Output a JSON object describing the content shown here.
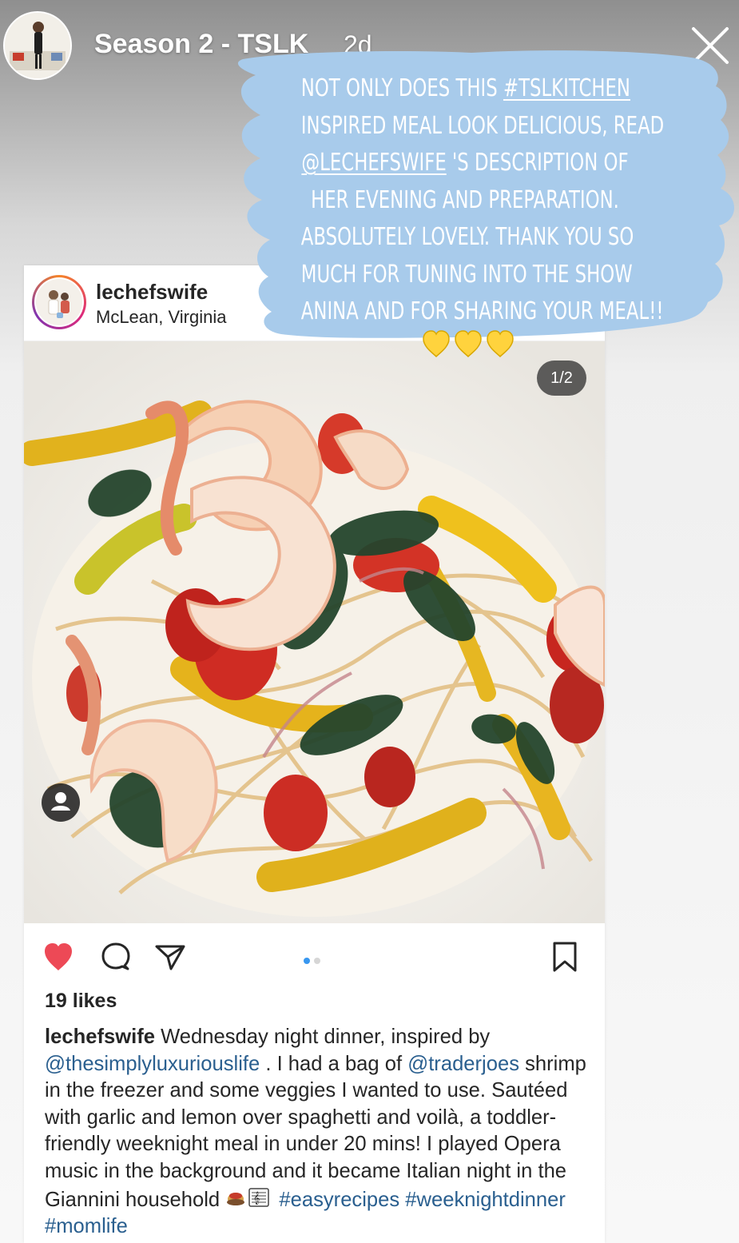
{
  "story": {
    "title": "Season 2 - TSLK",
    "time": "2d",
    "overlay_lines": [
      {
        "parts": [
          {
            "text": "Not only does this "
          },
          {
            "text": "#TSLKitchen",
            "u": true
          }
        ]
      },
      {
        "parts": [
          {
            "text": "inspired meal look delicious, read"
          }
        ]
      },
      {
        "parts": [
          {
            "text": "@lechefswife",
            "u": true
          },
          {
            "text": " 's description of"
          }
        ]
      },
      {
        "parts": [
          {
            "text": "her evening and preparation."
          }
        ]
      },
      {
        "parts": [
          {
            "text": "Absolutely lovely. Thank you so"
          }
        ]
      },
      {
        "parts": [
          {
            "text": "much for tuning into the show"
          }
        ]
      },
      {
        "parts": [
          {
            "text": "Anina and for sharing your meal!!"
          }
        ]
      }
    ],
    "overlay_hearts": "yellow-heart-emoji",
    "bubble_color": "#a8cbeb"
  },
  "post": {
    "username": "lechefswife",
    "location": "McLean, Virginia",
    "image_counter": "1/2",
    "likes": "19 likes",
    "caption": {
      "username": "lechefswife",
      "t1": " Wednesday night dinner, inspired by ",
      "mention1": "@thesimplyluxuriouslife",
      "t2": " . I had a bag of ",
      "mention2": "@traderjoes",
      "t3": " shrimp in the freezer and some veggies I wanted to use. Sautéed with garlic and lemon over spaghetti and voilà, a toddler-friendly weeknight meal in under 20 mins! I played Opera music in the background and it became Italian night in the Giannini household ",
      "emojis": "spaghetti-emoji musical-score-emoji",
      "t4": " ",
      "hashtags": "#easyrecipes #weeknightdinner #momlife"
    },
    "colors": {
      "like": "#ed4956",
      "link": "#2a5f8f",
      "active_dot": "#3897f0"
    }
  }
}
